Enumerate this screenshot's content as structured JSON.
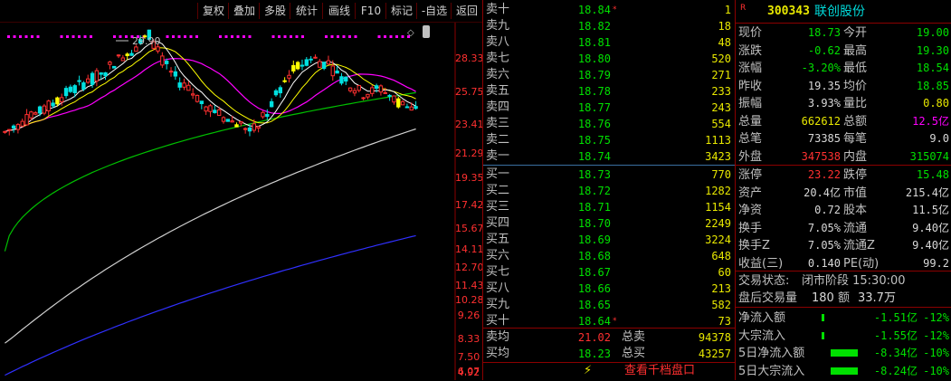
{
  "toolbar": {
    "buttons": [
      "复权",
      "叠加",
      "多股",
      "统计",
      "画线",
      "F10",
      "标记",
      "-自选",
      "返回"
    ]
  },
  "chart": {
    "peak_label": "29.90",
    "y_ticks": [
      "28.33",
      "25.75",
      "23.41",
      "21.29",
      "19.35",
      "17.42",
      "15.67",
      "14.11",
      "12.70",
      "11.43",
      "10.28",
      "9.26",
      "8.33",
      "7.50",
      "6.07",
      "4.92"
    ],
    "colors": {
      "up": "#ff3030",
      "down": "#00e0e0",
      "ma5": "#ffffff",
      "ma10": "#ffff00",
      "ma20": "#ff00ff",
      "ma60": "#00c000",
      "ma120": "#d0d0d0",
      "ma250": "#3030ff"
    }
  },
  "orderbook": {
    "asks": [
      {
        "label": "卖十",
        "price": "18.84",
        "vol": "1",
        "mark": "*"
      },
      {
        "label": "卖九",
        "price": "18.82",
        "vol": "18"
      },
      {
        "label": "卖八",
        "price": "18.81",
        "vol": "48"
      },
      {
        "label": "卖七",
        "price": "18.80",
        "vol": "520"
      },
      {
        "label": "卖六",
        "price": "18.79",
        "vol": "271"
      },
      {
        "label": "卖五",
        "price": "18.78",
        "vol": "233"
      },
      {
        "label": "卖四",
        "price": "18.77",
        "vol": "243"
      },
      {
        "label": "卖三",
        "price": "18.76",
        "vol": "554"
      },
      {
        "label": "卖二",
        "price": "18.75",
        "vol": "1113"
      },
      {
        "label": "卖一",
        "price": "18.74",
        "vol": "3423"
      }
    ],
    "bids": [
      {
        "label": "买一",
        "price": "18.73",
        "vol": "770"
      },
      {
        "label": "买二",
        "price": "18.72",
        "vol": "1282"
      },
      {
        "label": "买三",
        "price": "18.71",
        "vol": "1154"
      },
      {
        "label": "买四",
        "price": "18.70",
        "vol": "2249"
      },
      {
        "label": "买五",
        "price": "18.69",
        "vol": "3224"
      },
      {
        "label": "买六",
        "price": "18.68",
        "vol": "648"
      },
      {
        "label": "买七",
        "price": "18.67",
        "vol": "60"
      },
      {
        "label": "买八",
        "price": "18.66",
        "vol": "213"
      },
      {
        "label": "买九",
        "price": "18.65",
        "vol": "582"
      },
      {
        "label": "买十",
        "price": "18.64",
        "vol": "73",
        "mark": "*"
      }
    ],
    "avg": [
      {
        "label": "卖均",
        "price": "21.02",
        "label2": "总卖",
        "vol": "94378"
      },
      {
        "label": "买均",
        "price": "18.23",
        "label2": "总买",
        "vol": "43257"
      }
    ],
    "bottom_link": "查看千档盘口",
    "bolt": "⚡"
  },
  "stock": {
    "flag": "R",
    "code": "300343",
    "name": "联创股份"
  },
  "stats": [
    {
      "l": "现价",
      "v": "18.73",
      "vc": "g",
      "l2": "今开",
      "v2": "19.00",
      "v2c": "g"
    },
    {
      "l": "涨跌",
      "v": "-0.62",
      "vc": "g",
      "l2": "最高",
      "v2": "19.30",
      "v2c": "g"
    },
    {
      "l": "涨幅",
      "v": "-3.20%",
      "vc": "g",
      "l2": "最低",
      "v2": "18.54",
      "v2c": "g"
    },
    {
      "l": "昨收",
      "v": "19.35",
      "vc": "w",
      "l2": "均价",
      "v2": "18.85",
      "v2c": "g"
    },
    {
      "l": "振幅",
      "v": "3.93%",
      "vc": "w",
      "l2": "量比",
      "v2": "0.80",
      "v2c": "y"
    },
    {
      "l": "总量",
      "v": "662612",
      "vc": "y",
      "l2": "总额",
      "v2": "12.5亿",
      "v2c": "m"
    },
    {
      "l": "总笔",
      "v": "73385",
      "vc": "w",
      "l2": "每笔",
      "v2": "9.0",
      "v2c": "w"
    },
    {
      "l": "外盘",
      "v": "347538",
      "vc": "r",
      "l2": "内盘",
      "v2": "315074",
      "v2c": "g"
    }
  ],
  "stats2": [
    {
      "l": "涨停",
      "v": "23.22",
      "vc": "r",
      "l2": "跌停",
      "v2": "15.48",
      "v2c": "g"
    },
    {
      "l": "资产",
      "v": "20.4亿",
      "vc": "w",
      "l2": "市值",
      "v2": "215.4亿",
      "v2c": "w"
    },
    {
      "l": "净资",
      "v": "0.72",
      "vc": "w",
      "l2": "股本",
      "v2": "11.5亿",
      "v2c": "w"
    },
    {
      "l": "换手",
      "v": "7.05%",
      "vc": "w",
      "l2": "流通",
      "v2": "9.40亿",
      "v2c": "w"
    },
    {
      "l": "换手Z",
      "v": "7.05%",
      "vc": "w",
      "l2": "流通Z",
      "v2": "9.40亿",
      "v2c": "w"
    },
    {
      "l": "收益(三)",
      "v": "0.140",
      "vc": "w",
      "l2": "PE(动)",
      "v2": "99.2",
      "v2c": "w"
    }
  ],
  "trade_status": {
    "label": "交易状态:",
    "value": "闭市阶段 15:30:00"
  },
  "after_hours": {
    "label": "盘后交易量",
    "vol": "180",
    "label2": "额",
    "amount": "33.7万"
  },
  "flows": [
    {
      "label": "净流入额",
      "bar": 0.05,
      "amount": "-1.51亿",
      "pct": "-12%"
    },
    {
      "label": "大宗流入",
      "bar": 0.05,
      "amount": "-1.55亿",
      "pct": "-12%"
    },
    {
      "label": "5日净流入额",
      "bar": 1.0,
      "amount": "-8.34亿",
      "pct": "-10%"
    },
    {
      "label": "5日大宗流入",
      "bar": 1.0,
      "amount": "-8.24亿",
      "pct": "-10%"
    }
  ]
}
